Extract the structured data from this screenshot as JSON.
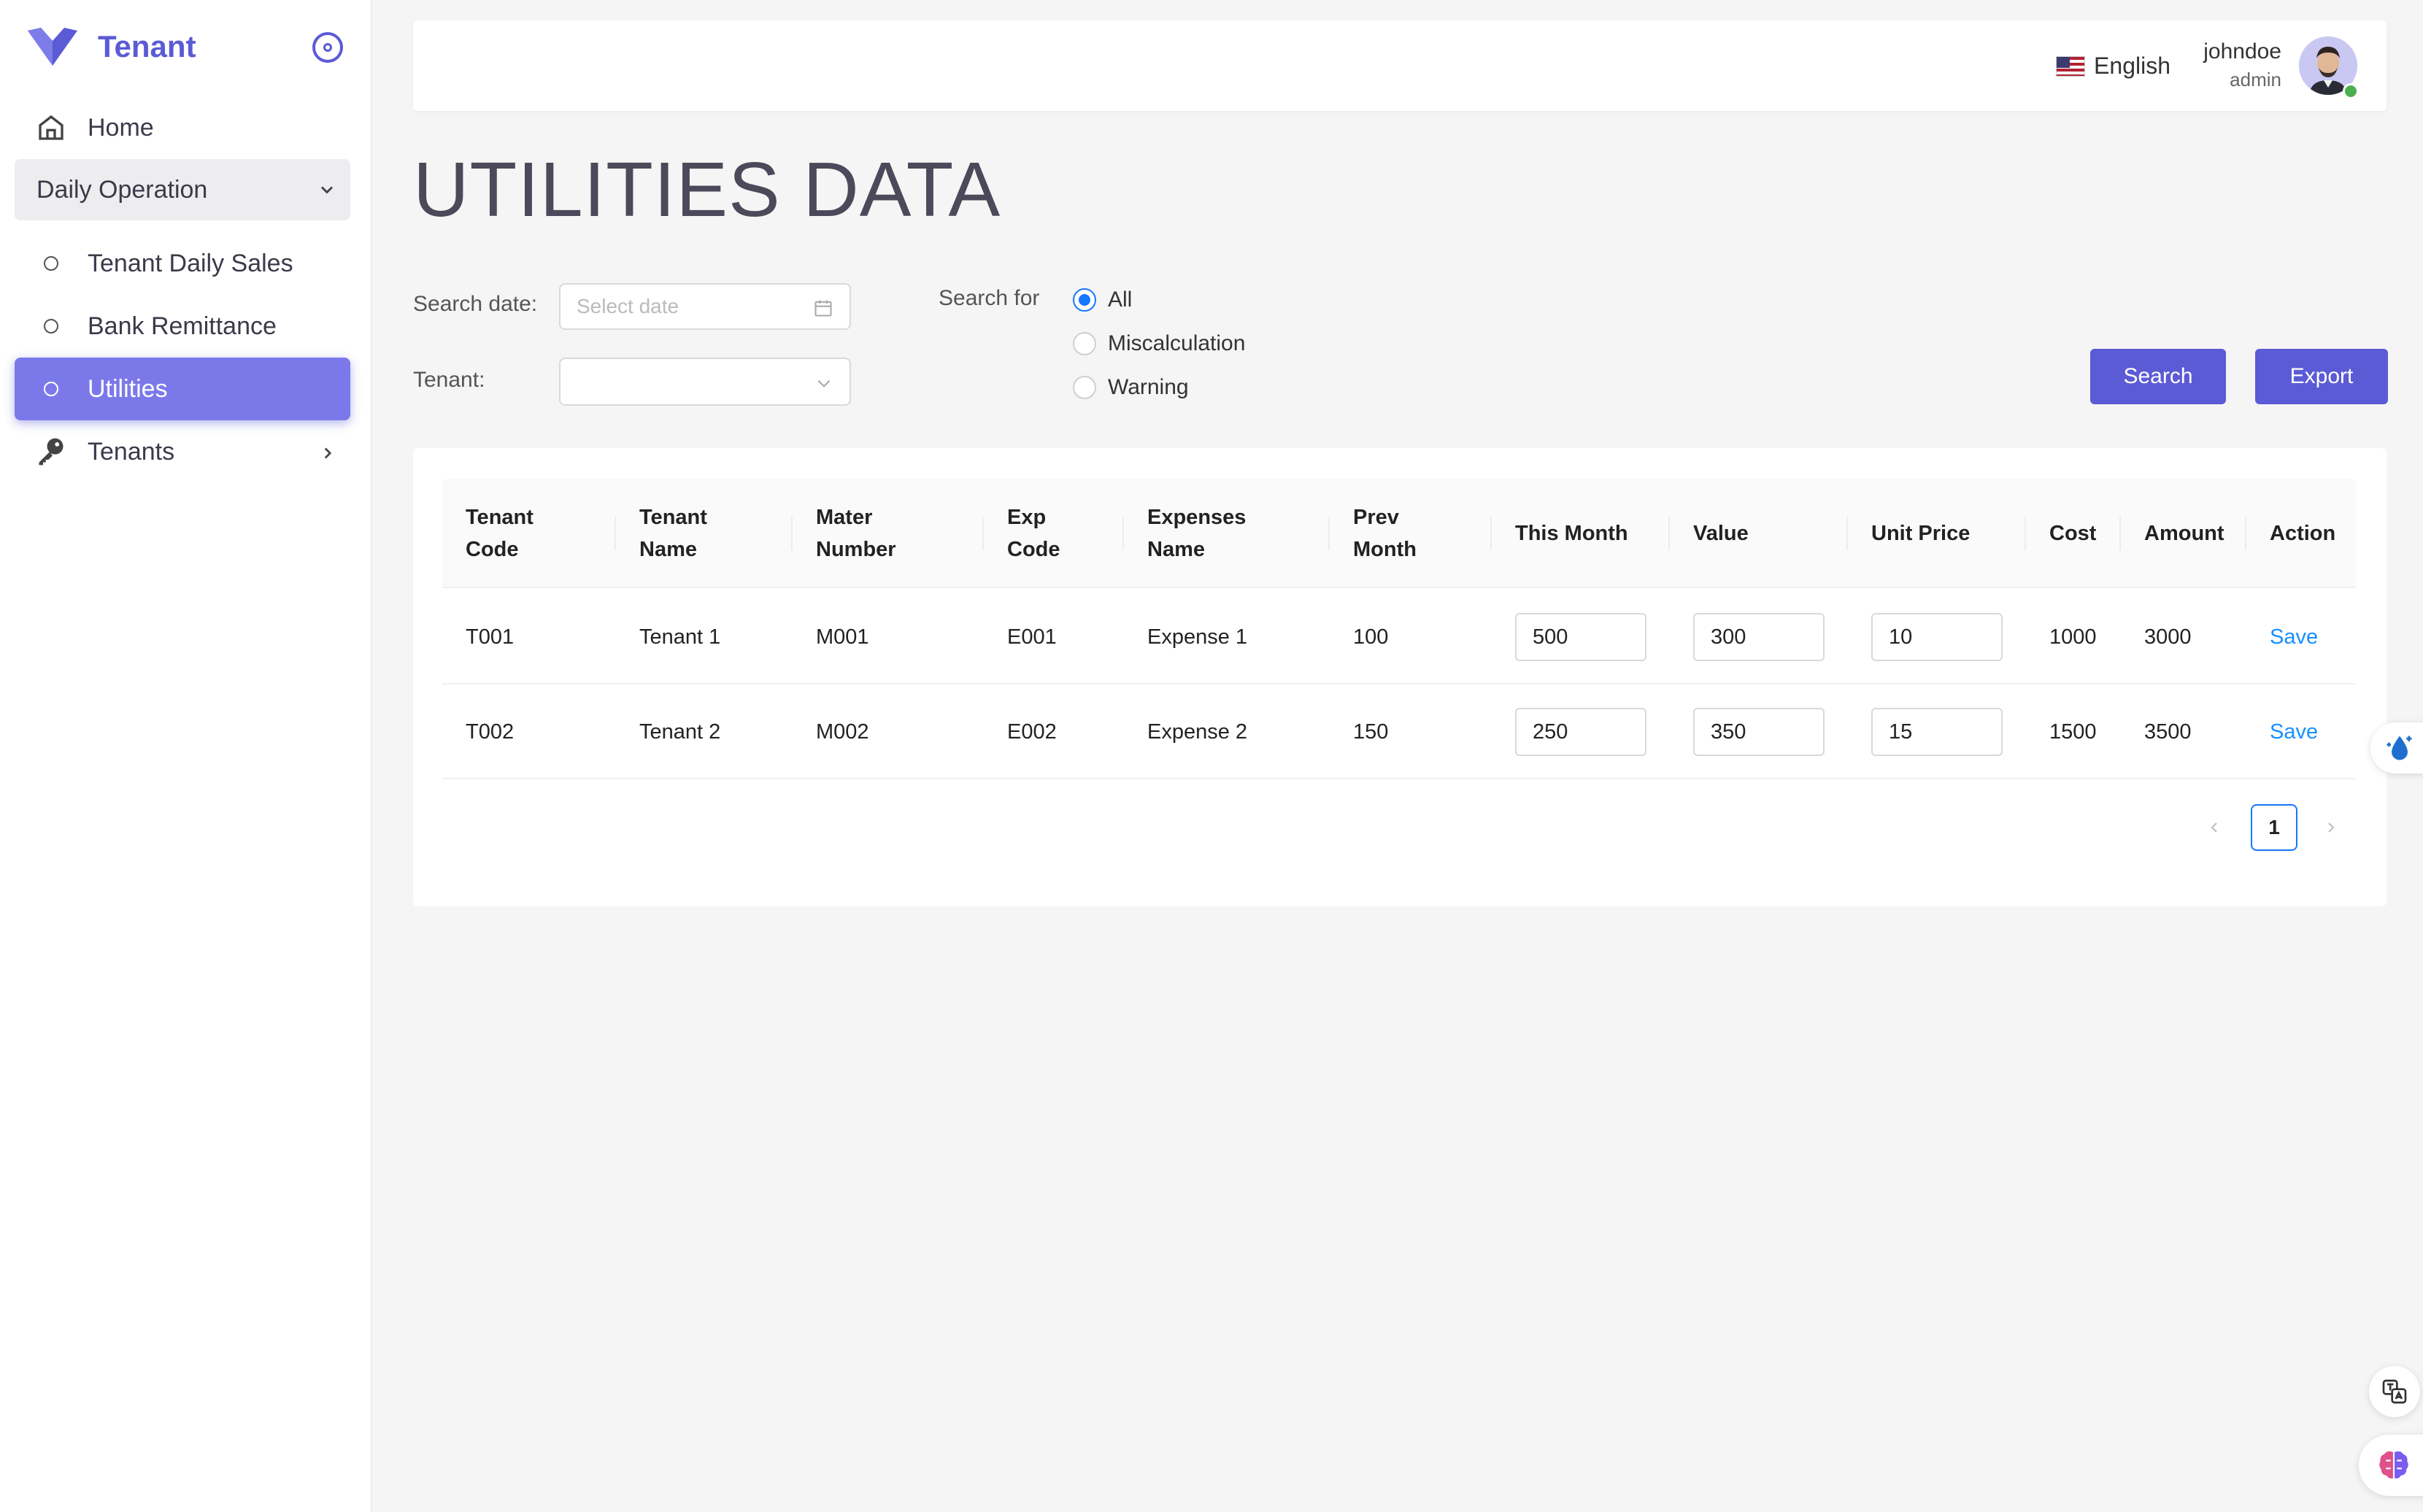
{
  "brand": {
    "name": "Tenant",
    "accent": "#5b5bd6"
  },
  "sidebar": {
    "home": "Home",
    "group": "Daily Operation",
    "items": [
      "Tenant Daily Sales",
      "Bank Remittance",
      "Utilities"
    ],
    "active": "Utilities",
    "tenants": "Tenants"
  },
  "header": {
    "language": "English",
    "username": "johndoe",
    "role": "admin"
  },
  "page": {
    "title": "UTILITIES DATA"
  },
  "filters": {
    "search_date_label": "Search date:",
    "date_placeholder": "Select date",
    "tenant_label": "Tenant:",
    "tenant_value": "",
    "search_for_label": "Search for",
    "options": [
      "All",
      "Miscalculation",
      "Warning"
    ],
    "selected": "All"
  },
  "buttons": {
    "search": "Search",
    "export": "Export"
  },
  "table": {
    "headers": {
      "tenant_code": [
        "Tenant",
        "Code"
      ],
      "tenant_name": [
        "Tenant",
        "Name"
      ],
      "mater_number": [
        "Mater",
        "Number"
      ],
      "exp_code": [
        "Exp",
        "Code"
      ],
      "expenses_name": [
        "Expenses",
        "Name"
      ],
      "prev_month": [
        "Prev",
        "Month"
      ],
      "this_month": "This Month",
      "value": "Value",
      "unit_price": "Unit Price",
      "cost": "Cost",
      "amount": "Amount",
      "action": "Action"
    },
    "rows": [
      {
        "tenant_code": "T001",
        "tenant_name": "Tenant 1",
        "mater_number": "M001",
        "exp_code": "E001",
        "expenses_name": "Expense 1",
        "prev_month": "100",
        "this_month": "500",
        "value": "300",
        "unit_price": "10",
        "cost": "1000",
        "amount": "3000",
        "action": "Save"
      },
      {
        "tenant_code": "T002",
        "tenant_name": "Tenant 2",
        "mater_number": "M002",
        "exp_code": "E002",
        "expenses_name": "Expense 2",
        "prev_month": "150",
        "this_month": "250",
        "value": "350",
        "unit_price": "15",
        "cost": "1500",
        "amount": "3500",
        "action": "Save"
      }
    ]
  },
  "pagination": {
    "current": "1"
  }
}
